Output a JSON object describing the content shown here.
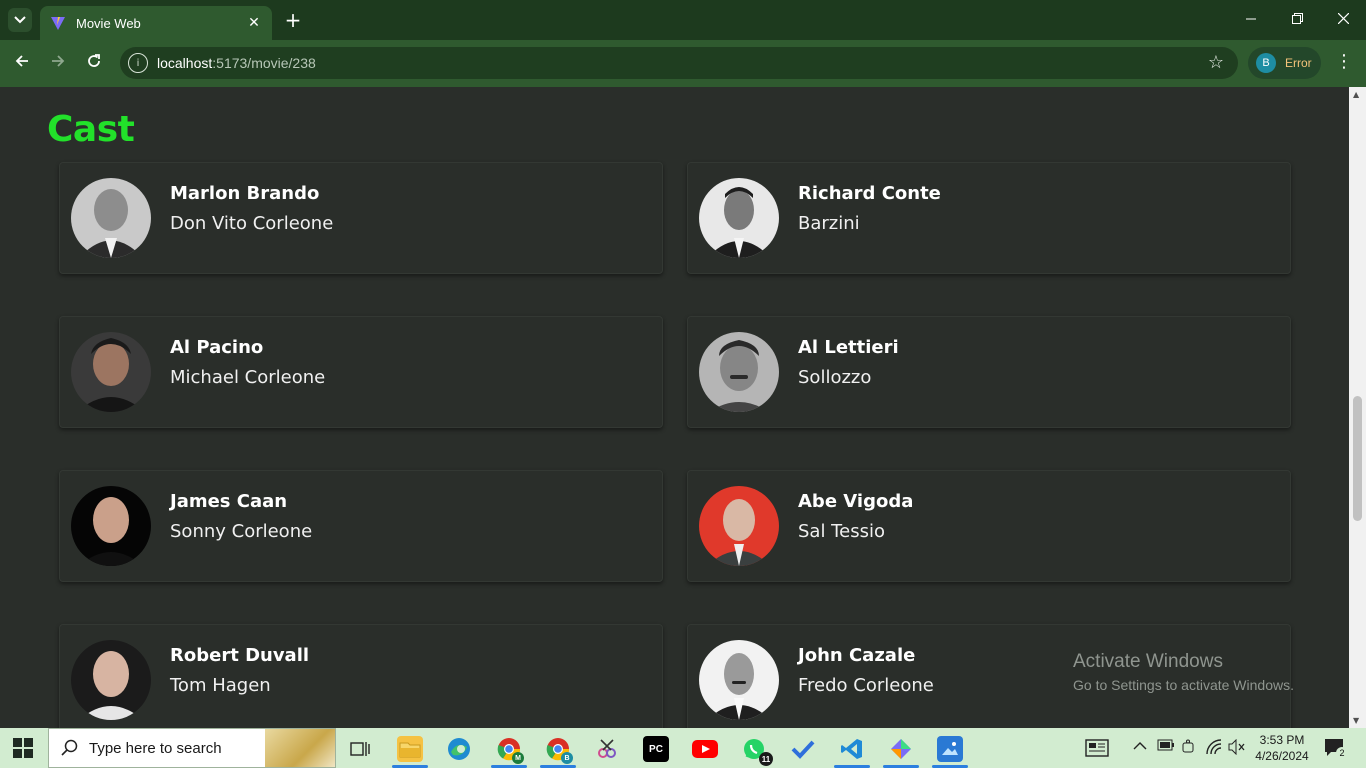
{
  "browser": {
    "tab_title": "Movie Web",
    "tab_close": "✕",
    "new_tab": "+",
    "url_host": "localhost",
    "url_path": ":5173/movie/238",
    "profile_initial": "B",
    "profile_status": "Error"
  },
  "page": {
    "section_title": "Cast",
    "cast": [
      {
        "name": "Marlon Brando",
        "character": "Don Vito Corleone"
      },
      {
        "name": "Richard Conte",
        "character": "Barzini"
      },
      {
        "name": "Al Pacino",
        "character": "Michael Corleone"
      },
      {
        "name": "Al Lettieri",
        "character": "Sollozzo"
      },
      {
        "name": "James Caan",
        "character": "Sonny Corleone"
      },
      {
        "name": "Abe Vigoda",
        "character": "Sal Tessio"
      },
      {
        "name": "Robert Duvall",
        "character": "Tom Hagen"
      },
      {
        "name": "John Cazale",
        "character": "Fredo Corleone"
      }
    ]
  },
  "watermark": {
    "title": "Activate Windows",
    "subtitle": "Go to Settings to activate Windows."
  },
  "taskbar": {
    "search_placeholder": "Type here to search",
    "time": "3:53 PM",
    "date": "4/26/2024",
    "whatsapp_badge": "11",
    "notification_count": "2",
    "chrome_m_badge": "M",
    "chrome_b_badge": "B",
    "pycharm_label": "PC"
  },
  "colors": {
    "accent": "#22e12a",
    "background": "#2a2e2a",
    "browser_frame": "#1d3a1e",
    "toolbar": "#2f5a2f"
  }
}
